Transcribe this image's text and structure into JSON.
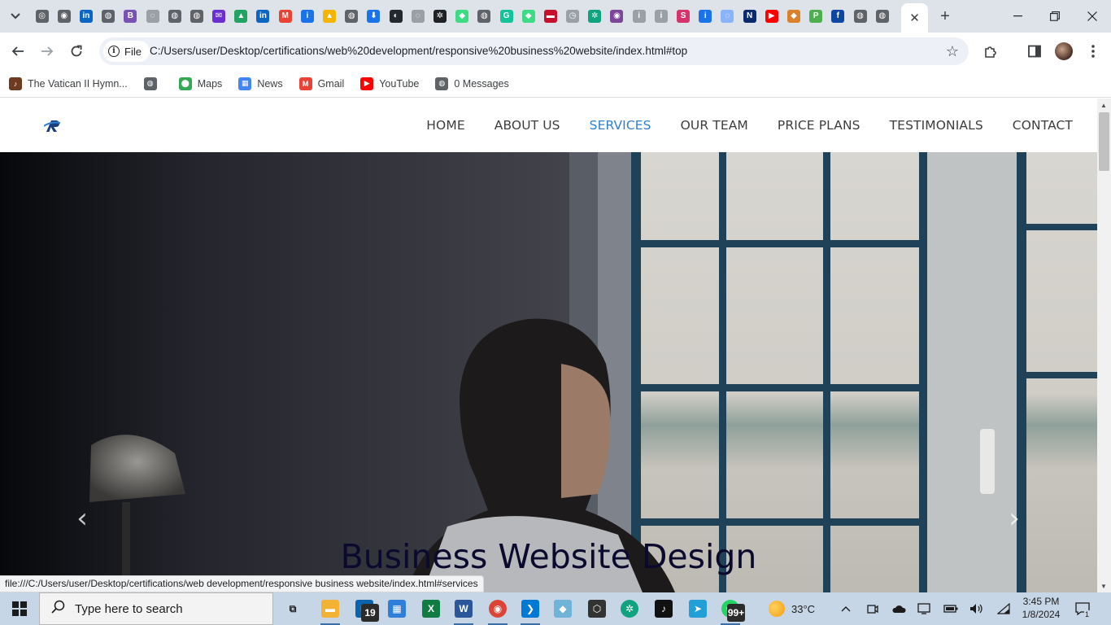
{
  "browser": {
    "active_tab_close": "✕",
    "new_tab": "+",
    "address": {
      "scheme_label": "File",
      "url": "C:/Users/user/Desktop/certifications/web%20development/responsive%20business%20website/index.html#top"
    },
    "status_bar_url": "file:///C:/Users/user/Desktop/certifications/web development/responsive business website/index.html#services",
    "tab_favicons": [
      {
        "name": "chrome-icon",
        "color": "#5f6368",
        "glyph": "◎"
      },
      {
        "name": "chromium-icon",
        "color": "#5f6368",
        "glyph": "◉"
      },
      {
        "name": "linkedin-icon",
        "color": "#0a66c2",
        "glyph": "in"
      },
      {
        "name": "globe-icon",
        "color": "#5f6368",
        "glyph": "◍"
      },
      {
        "name": "bootstrap-icon",
        "color": "#7952b3",
        "glyph": "B"
      },
      {
        "name": "loading-icon",
        "color": "#9aa0a6",
        "glyph": "◌"
      },
      {
        "name": "globe-icon",
        "color": "#5f6368",
        "glyph": "◍"
      },
      {
        "name": "globe-icon",
        "color": "#5f6368",
        "glyph": "◍"
      },
      {
        "name": "mail-icon",
        "color": "#6b2fd1",
        "glyph": "✉"
      },
      {
        "name": "google-drive-icon",
        "color": "#1fa463",
        "glyph": "▲"
      },
      {
        "name": "linkedin-icon",
        "color": "#0a66c2",
        "glyph": "in"
      },
      {
        "name": "gmail-icon",
        "color": "#ea4335",
        "glyph": "M"
      },
      {
        "name": "info-icon",
        "color": "#1a73e8",
        "glyph": "i"
      },
      {
        "name": "drive-icon",
        "color": "#f4b400",
        "glyph": "▲"
      },
      {
        "name": "globe-icon",
        "color": "#5f6368",
        "glyph": "◍"
      },
      {
        "name": "download-icon",
        "color": "#1a73e8",
        "glyph": "⬇"
      },
      {
        "name": "github-icon",
        "color": "#24292f",
        "glyph": "◐"
      },
      {
        "name": "loading-icon",
        "color": "#9aa0a6",
        "glyph": "◌"
      },
      {
        "name": "openai-icon",
        "color": "#202124",
        "glyph": "✲"
      },
      {
        "name": "android-icon",
        "color": "#3ddc84",
        "glyph": "◆"
      },
      {
        "name": "globe-icon",
        "color": "#5f6368",
        "glyph": "◍"
      },
      {
        "name": "grammarly-icon",
        "color": "#15c39a",
        "glyph": "G"
      },
      {
        "name": "android-icon",
        "color": "#3ddc84",
        "glyph": "◆"
      },
      {
        "name": "flag-icon",
        "color": "#c8102e",
        "glyph": "▬"
      },
      {
        "name": "clock-icon",
        "color": "#9aa0a6",
        "glyph": "◷"
      },
      {
        "name": "ai-icon",
        "color": "#10a37f",
        "glyph": "✲"
      },
      {
        "name": "tor-icon",
        "color": "#7d4698",
        "glyph": "◉"
      },
      {
        "name": "info-icon",
        "color": "#9aa0a6",
        "glyph": "i"
      },
      {
        "name": "info-icon",
        "color": "#9aa0a6",
        "glyph": "i"
      },
      {
        "name": "s-icon",
        "color": "#d6336c",
        "glyph": "S"
      },
      {
        "name": "info-icon",
        "color": "#1a73e8",
        "glyph": "i"
      },
      {
        "name": "loading-icon",
        "color": "#8ab4f8",
        "glyph": "◌"
      },
      {
        "name": "n-icon",
        "color": "#0b2a6b",
        "glyph": "N"
      },
      {
        "name": "youtube-icon",
        "color": "#ff0000",
        "glyph": "▶"
      },
      {
        "name": "shield-icon",
        "color": "#d9822b",
        "glyph": "◆"
      },
      {
        "name": "p-icon",
        "color": "#4caf50",
        "glyph": "P"
      },
      {
        "name": "f-icon",
        "color": "#0d47a1",
        "glyph": "f"
      },
      {
        "name": "globe-icon",
        "color": "#5f6368",
        "glyph": "◍"
      },
      {
        "name": "globe-icon",
        "color": "#5f6368",
        "glyph": "◍"
      }
    ],
    "bookmarks": [
      {
        "label": "The Vatican II Hymn...",
        "icon": "hymnal-icon",
        "color": "#6d3b1f",
        "glyph": "♪"
      },
      {
        "label": "",
        "icon": "globe-icon",
        "color": "#5f6368",
        "glyph": "◍"
      },
      {
        "label": "Maps",
        "icon": "maps-icon",
        "color": "#34a853",
        "glyph": "⬤"
      },
      {
        "label": "News",
        "icon": "news-icon",
        "color": "#4285f4",
        "glyph": "▦"
      },
      {
        "label": "Gmail",
        "icon": "gmail-icon",
        "color": "#ea4335",
        "glyph": "M"
      },
      {
        "label": "YouTube",
        "icon": "youtube-icon",
        "color": "#ff0000",
        "glyph": "▶"
      },
      {
        "label": "0 Messages",
        "icon": "globe-icon",
        "color": "#5f6368",
        "glyph": "◍"
      }
    ]
  },
  "site": {
    "nav": [
      {
        "label": "HOME",
        "active": false
      },
      {
        "label": "ABOUT US",
        "active": false
      },
      {
        "label": "SERVICES",
        "active": true
      },
      {
        "label": "OUR TEAM",
        "active": false
      },
      {
        "label": "PRICE PLANS",
        "active": false
      },
      {
        "label": "TESTIMONIALS",
        "active": false
      },
      {
        "label": "CONTACT",
        "active": false
      }
    ],
    "hero": {
      "title": "Business Website Design",
      "prev_arrow": "‹",
      "next_arrow": "›"
    },
    "colors": {
      "nav_active": "#2f7fd0",
      "nav_default": "#3d3d3d",
      "hero_title": "#0b0a2e"
    }
  },
  "taskbar": {
    "search_placeholder": "Type here to search",
    "apps": [
      {
        "name": "task-view-icon",
        "color": "#1b1b1b",
        "glyph": "⧉",
        "open": false,
        "badge": ""
      },
      {
        "name": "file-explorer-icon",
        "color": "#f2b233",
        "glyph": "▬",
        "open": true,
        "badge": ""
      },
      {
        "name": "mail-icon",
        "color": "#0a64ad",
        "glyph": "✉",
        "open": false,
        "badge": "19"
      },
      {
        "name": "store-icon",
        "color": "#2f7ed8",
        "glyph": "▦",
        "open": false,
        "badge": ""
      },
      {
        "name": "excel-icon",
        "color": "#107c41",
        "glyph": "X",
        "open": false,
        "badge": ""
      },
      {
        "name": "word-icon",
        "color": "#2b579a",
        "glyph": "W",
        "open": true,
        "badge": ""
      },
      {
        "name": "chrome-icon",
        "color": "#db4437",
        "glyph": "◉",
        "open": true,
        "badge": ""
      },
      {
        "name": "vscode-icon",
        "color": "#0078d4",
        "glyph": "❯",
        "open": true,
        "badge": ""
      },
      {
        "name": "ink-icon",
        "color": "#6fb3d8",
        "glyph": "◆",
        "open": false,
        "badge": ""
      },
      {
        "name": "cube-icon",
        "color": "#333333",
        "glyph": "⬡",
        "open": false,
        "badge": ""
      },
      {
        "name": "chatgpt-icon",
        "color": "#10a37f",
        "glyph": "✲",
        "open": false,
        "badge": ""
      },
      {
        "name": "tiktok-icon",
        "color": "#111111",
        "glyph": "♪",
        "open": false,
        "badge": ""
      },
      {
        "name": "telegram-icon",
        "color": "#229ed9",
        "glyph": "➤",
        "open": false,
        "badge": ""
      },
      {
        "name": "whatsapp-icon",
        "color": "#25d366",
        "glyph": "✆",
        "open": true,
        "badge": "99+"
      }
    ],
    "weather": "33°C",
    "time": "3:45 PM",
    "date": "1/8/2024",
    "notifications": "1"
  }
}
